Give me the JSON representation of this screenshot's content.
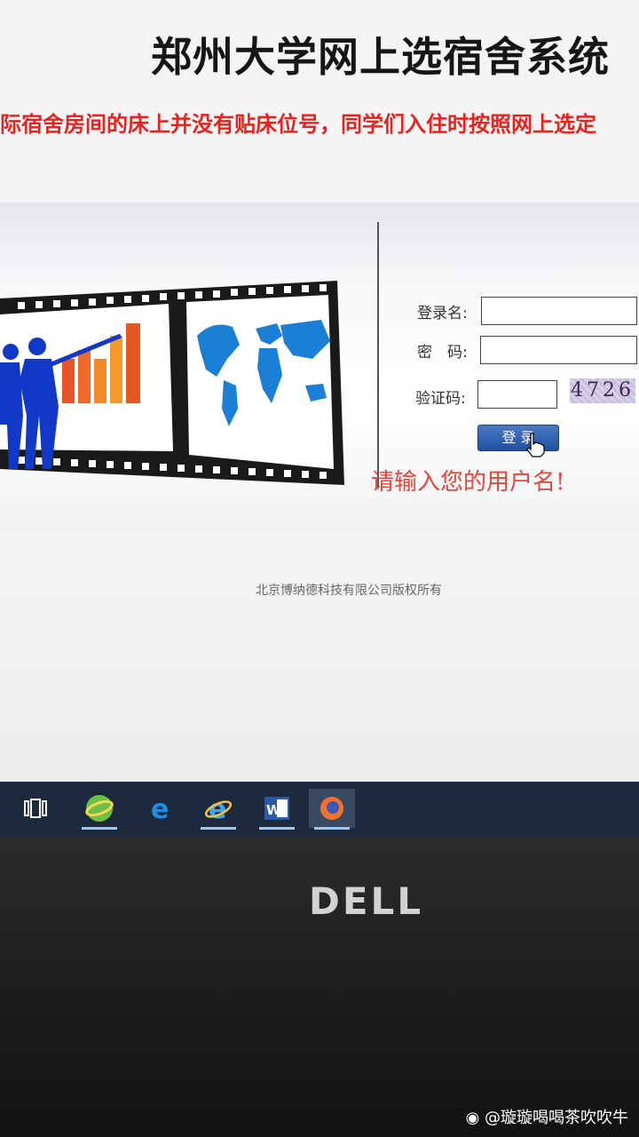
{
  "page": {
    "title": "郑州大学网上选宿舍系统",
    "notice": "际宿舍房间的床上并没有贴床位号，同学们入住时按照网上选定"
  },
  "login": {
    "username_label": "登录名:",
    "password_label": "密　码:",
    "captcha_label": "验证码:",
    "captcha_code": "4726",
    "login_button": "登 录",
    "error_message": "请输入您的用户名!"
  },
  "footer": {
    "copyright": "北京博纳德科技有限公司版权所有"
  },
  "taskbar": {
    "items": [
      {
        "icon": "task-view-icon"
      },
      {
        "icon": "browser-360-icon"
      },
      {
        "icon": "edge-icon"
      },
      {
        "icon": "internet-explorer-icon"
      },
      {
        "icon": "word-icon"
      },
      {
        "icon": "firefox-icon"
      }
    ]
  },
  "hardware": {
    "brand": "DELL"
  },
  "watermark": {
    "text": "@璇璇喝喝茶吹吹牛"
  },
  "colors": {
    "notice_red": "#e5231f",
    "error_red": "#e34738",
    "button_blue": "#1f4f9f",
    "taskbar_bg": "#1d2a3e"
  }
}
